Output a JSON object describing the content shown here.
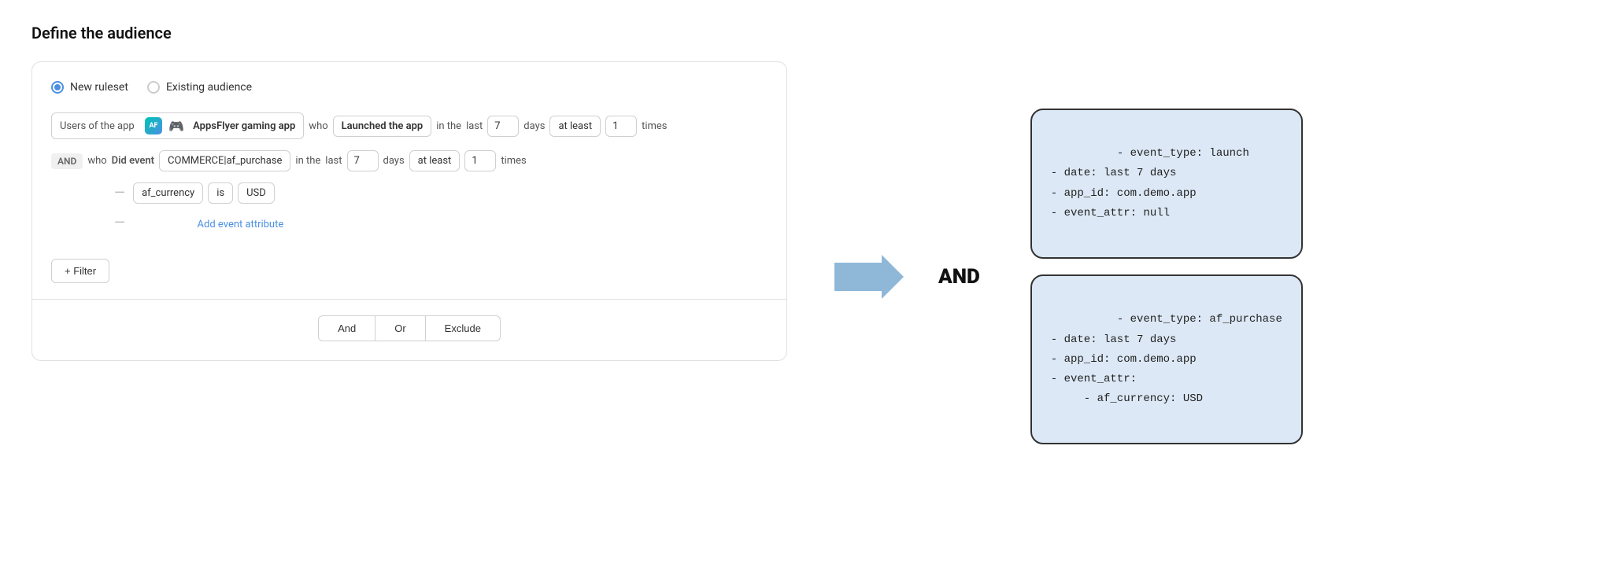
{
  "page": {
    "title": "Define the audience"
  },
  "radio": {
    "option1": "New ruleset",
    "option2": "Existing audience"
  },
  "row1": {
    "users_of": "Users of the app",
    "app_name": "AppsFlyer gaming app",
    "who": "who",
    "launched": "Launched the app",
    "in_the": "in the",
    "last": "last",
    "days_value": "7",
    "days": "days",
    "at_least": "at least",
    "times_value": "1",
    "times": "times"
  },
  "row2": {
    "and_badge": "AND",
    "who": "who",
    "did_event": "Did event",
    "event_name": "COMMERCE|af_purchase",
    "in_the": "in the",
    "last": "last",
    "days_value": "7",
    "days": "days",
    "at_least": "at least",
    "times_value": "1",
    "times": "times"
  },
  "attr_row": {
    "attr_name": "af_currency",
    "is_label": "is",
    "attr_value": "USD"
  },
  "add_event_attr": "Add event attribute",
  "filter_button": "+ Filter",
  "actions": {
    "and": "And",
    "or": "Or",
    "exclude": "Exclude"
  },
  "info_box1": {
    "content": "- event_type: launch\n- date: last 7 days\n- app_id: com.demo.app\n- event_attr: null"
  },
  "info_box2": {
    "content": "- event_type: af_purchase\n- date: last 7 days\n- app_id: com.demo.app\n- event_attr:\n     - af_currency: USD"
  },
  "and_label": "AND"
}
